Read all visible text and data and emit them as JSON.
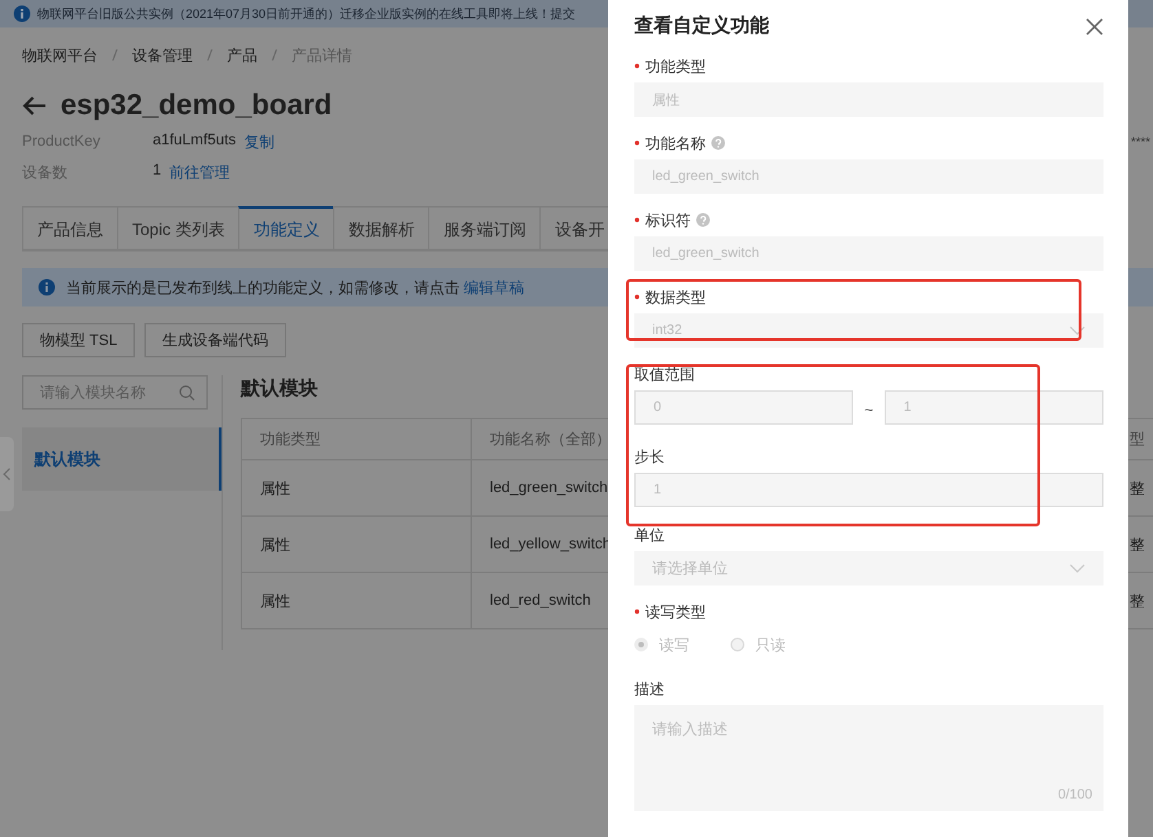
{
  "banner": {
    "text": "物联网平台旧版公共实例（2021年07月30日前开通的）迁移企业版实例的在线工具即将上线！提交"
  },
  "breadcrumb": [
    "物联网平台",
    "设备管理",
    "产品",
    "产品详情"
  ],
  "title": "esp32_demo_board",
  "meta": [
    {
      "label": "ProductKey",
      "value": "a1fuLmf5uts",
      "link": "复制",
      "extra": "****"
    },
    {
      "label": "设备数",
      "value": "1",
      "link": "前往管理"
    }
  ],
  "tabs": [
    {
      "label": "产品信息",
      "selected": false
    },
    {
      "label": "Topic 类列表",
      "selected": false
    },
    {
      "label": "功能定义",
      "selected": true
    },
    {
      "label": "数据解析",
      "selected": false
    },
    {
      "label": "服务端订阅",
      "selected": false
    },
    {
      "label": "设备开",
      "selected": false
    }
  ],
  "notice": {
    "text": "当前展示的是已发布到线上的功能定义，如需修改，请点击",
    "link": "编辑草稿"
  },
  "toolbar": [
    "物模型 TSL",
    "生成设备端代码"
  ],
  "module_search": {
    "placeholder": "请输入模块名称"
  },
  "modules": [
    {
      "label": "默认模块",
      "selected": true
    }
  ],
  "module_title": "默认模块",
  "table": {
    "columns": [
      "功能类型",
      "功能名称（全部）",
      "",
      "型"
    ],
    "rows": [
      [
        "属性",
        "led_green_switch",
        "",
        "整"
      ],
      [
        "属性",
        "led_yellow_switch",
        "",
        "整"
      ],
      [
        "属性",
        "led_red_switch",
        "",
        "整"
      ]
    ]
  },
  "drawer": {
    "title": "查看自定义功能",
    "disabled": true,
    "fields": [
      {
        "kind": "input",
        "label": "功能类型",
        "required": true,
        "help": false,
        "value": "属性"
      },
      {
        "kind": "input",
        "label": "功能名称",
        "required": true,
        "help": true,
        "value": "led_green_switch"
      },
      {
        "kind": "input",
        "label": "标识符",
        "required": true,
        "help": true,
        "value": "led_green_switch"
      },
      {
        "kind": "select",
        "label": "数据类型",
        "required": true,
        "help": false,
        "value": "int32"
      },
      {
        "kind": "range",
        "label": "取值范围",
        "required": false,
        "help": false,
        "from": "0",
        "sep": "~",
        "to": "1"
      },
      {
        "kind": "input",
        "label": "步长",
        "required": false,
        "help": false,
        "value": "1",
        "bordered": true
      },
      {
        "kind": "select",
        "label": "单位",
        "required": false,
        "help": false,
        "placeholder": "请选择单位"
      },
      {
        "kind": "radio",
        "label": "读写类型",
        "required": true,
        "help": false,
        "options": [
          {
            "label": "读写",
            "selected": true
          },
          {
            "label": "只读",
            "selected": false
          }
        ]
      },
      {
        "kind": "textarea",
        "label": "描述",
        "required": false,
        "help": false,
        "placeholder": "请输入描述",
        "counter": "0/100"
      }
    ]
  }
}
